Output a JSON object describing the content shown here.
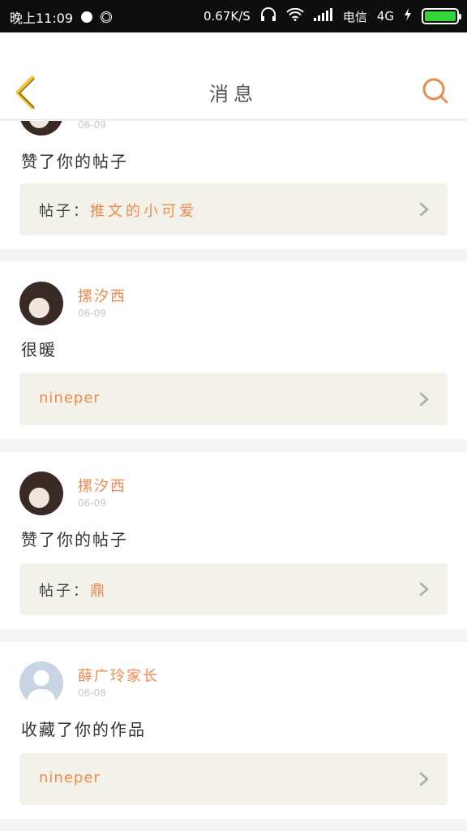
{
  "status_bar": {
    "time": "晚上11:09",
    "speed": "0.67K/S",
    "carrier": "电信",
    "network": "4G"
  },
  "header": {
    "title": "消息"
  },
  "posts": [
    {
      "date": "06-09",
      "message": "赞了你的帖子",
      "link_label": "帖子：",
      "link_value": "推文的小可爱"
    },
    {
      "name": "摞汐西",
      "date": "06-09",
      "message": "很暖",
      "link_label": "",
      "link_value": "nineper"
    },
    {
      "name": "摞汐西",
      "date": "06-09",
      "message": "赞了你的帖子",
      "link_label": "帖子：",
      "link_value": "鼎"
    },
    {
      "name": "薛广玲家长",
      "date": "06-08",
      "message": "收藏了你的作品",
      "link_label": "",
      "link_value": "nineper"
    }
  ],
  "colors": {
    "accent": "#f0894d",
    "back_icon": "#f2c230",
    "card_bg": "#f3f2ea"
  }
}
